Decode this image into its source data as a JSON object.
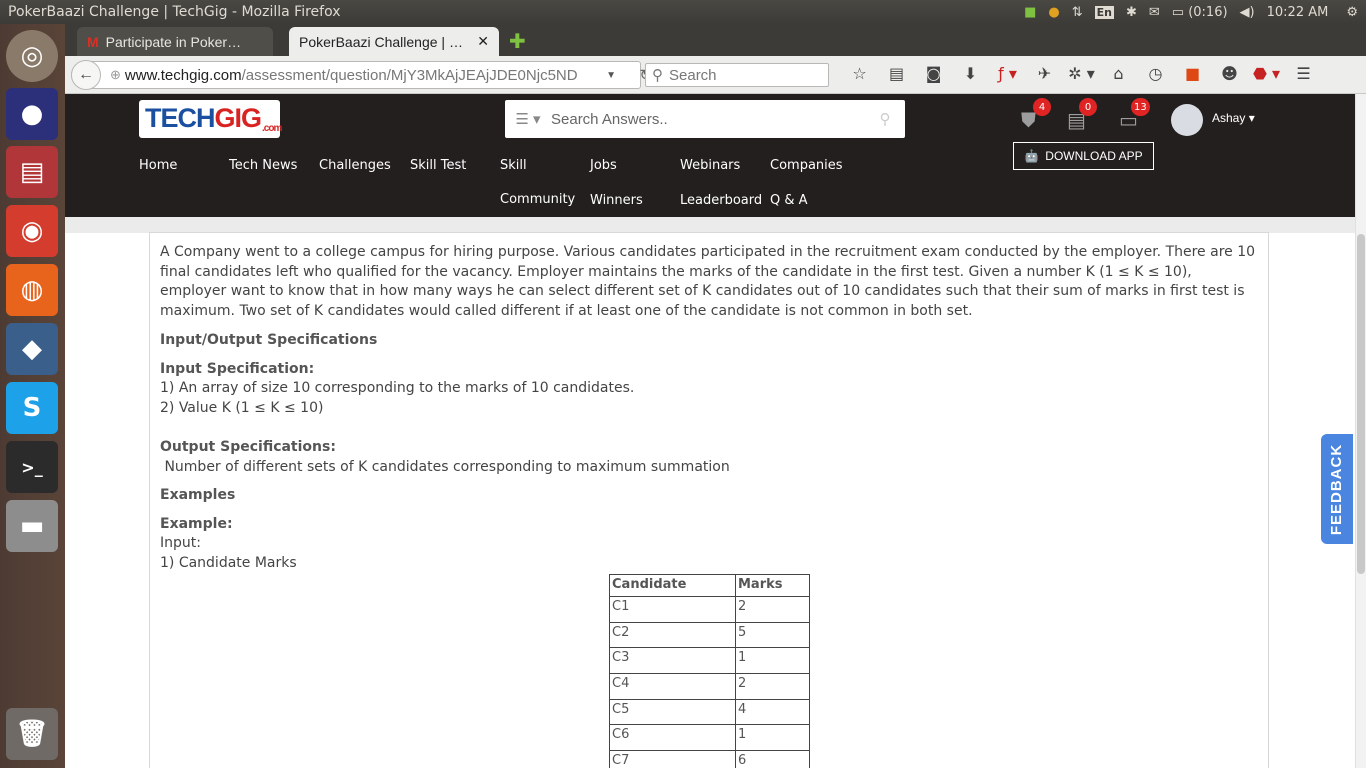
{
  "system": {
    "window_title": "PokerBaazi Challenge | TechGig - Mozilla Firefox",
    "lang": "En",
    "battery": "(0:16)",
    "time": "10:22 AM"
  },
  "tabs": [
    {
      "label": "Participate in Poker…",
      "icon": "gmail-icon"
    },
    {
      "label": "PokerBaazi Challenge | …",
      "icon": ""
    }
  ],
  "address_bar": {
    "domain": "www.techgig.com",
    "path": "/assessment/question/MjY3MkAjJEAjJDE0Njc5ND"
  },
  "browser_search": {
    "placeholder": "Search"
  },
  "site": {
    "logo_main": "TECH",
    "logo_accent": "GIG",
    "logo_suffix": ".com",
    "search_placeholder": "Search Answers..",
    "badges": {
      "shield": "4",
      "news": "0",
      "desktop": "13"
    },
    "username": "Ashay",
    "download_app": "DOWNLOAD APP",
    "menu_row1": [
      "Home",
      "Tech News",
      "Challenges",
      "Skill Test",
      "Skill",
      "Jobs",
      "Webinars",
      "Companies"
    ],
    "menu_row2": [
      "Community",
      "Winners",
      "Leaderboard",
      "Q & A"
    ]
  },
  "problem": {
    "statement": "A Company went to a college campus for hiring purpose. Various candidates participated in the recruitment exam conducted by the employer. There are 10 final candidates left who qualified for the vacancy. Employer maintains the marks of the candidate in the first test. Given a number K (1 ≤ K ≤ 10), employer want to know that in how many ways he can select different set of K candidates out of 10 candidates such that their sum of marks in first test is maximum. Two set of K candidates would called different if at least one of the candidate is not common in both set.",
    "io_heading": "Input/Output Specifications",
    "input_heading": "Input Specification:",
    "input_1": "1) An array of size 10 corresponding to the marks of 10 candidates.",
    "input_2": "2) Value K (1 ≤ K ≤ 10)",
    "output_heading": "Output Specifications:",
    "output_text": " Number of different sets of K candidates corresponding to maximum summation",
    "examples_heading": "Examples",
    "example_heading": "Example:",
    "input_label": "Input:",
    "candidate_marks_label": "1) Candidate Marks",
    "table": {
      "headers": [
        "Candidate",
        "Marks"
      ],
      "rows": [
        [
          "C1",
          "2"
        ],
        [
          "C2",
          "5"
        ],
        [
          "C3",
          "1"
        ],
        [
          "C4",
          "2"
        ],
        [
          "C5",
          "4"
        ],
        [
          "C6",
          "1"
        ],
        [
          "C7",
          "6"
        ]
      ]
    }
  },
  "feedback_label": "FEEDBACK"
}
